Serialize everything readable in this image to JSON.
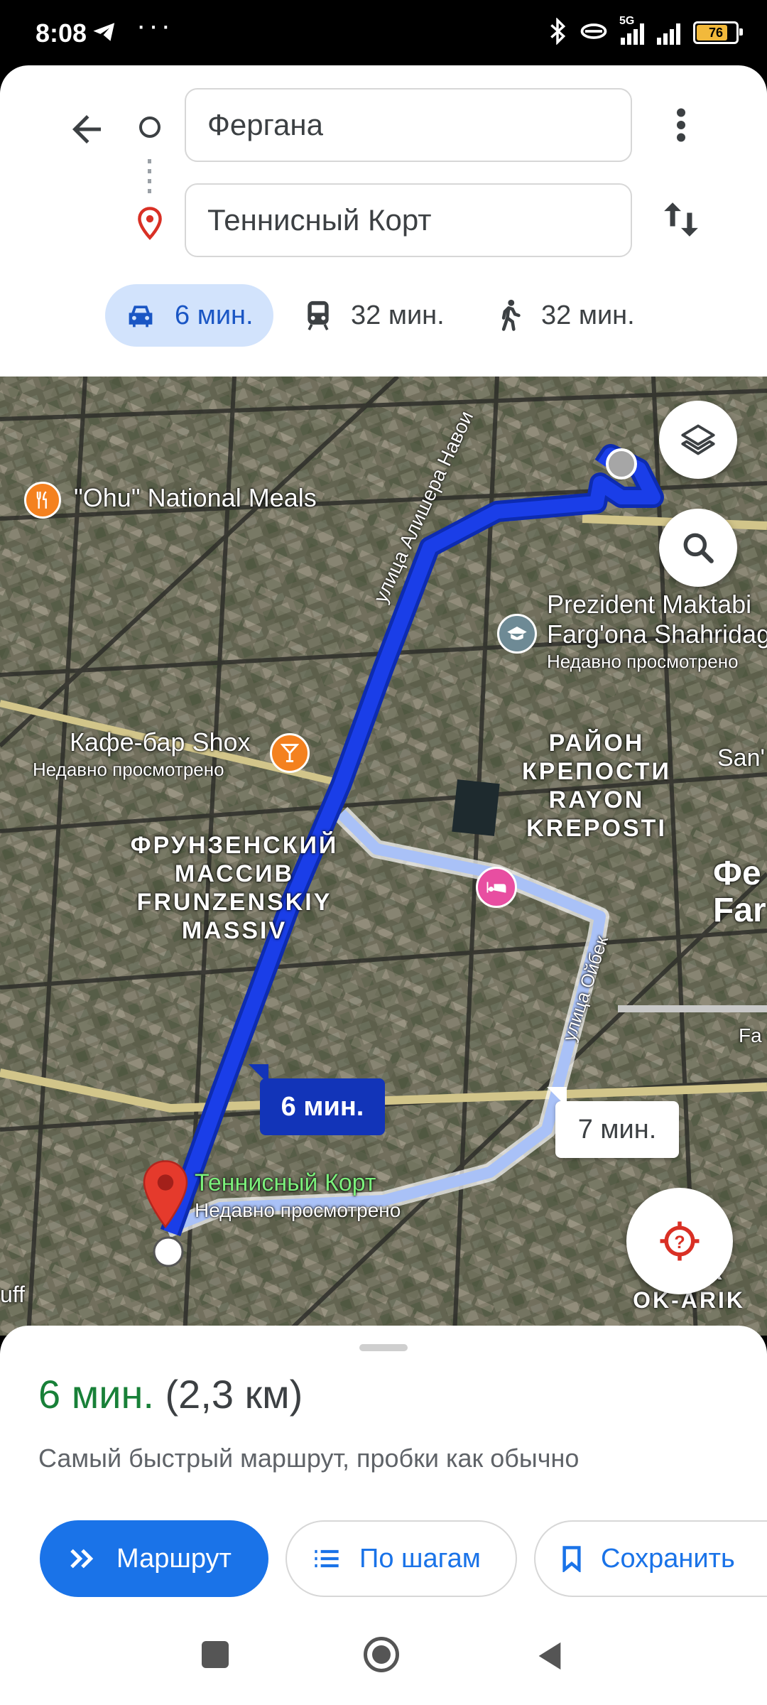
{
  "status_bar": {
    "time": "8:08",
    "network": "5G",
    "battery": "76",
    "icons": [
      "telegram-icon",
      "more-dots-icon",
      "bluetooth-icon",
      "link-icon",
      "signal-icon",
      "battery-icon"
    ]
  },
  "directions": {
    "origin": "Фергана",
    "destination": "Теннисный Корт",
    "modes": [
      {
        "icon": "car-icon",
        "label": "6 мин."
      },
      {
        "icon": "transit-icon",
        "label": "32 мин."
      },
      {
        "icon": "walk-icon",
        "label": "32 мин."
      }
    ]
  },
  "map": {
    "places": {
      "ohu": "\"Ohu\" National Meals",
      "president_line1": "Prezident Maktabi",
      "president_line2": "Farg'ona Shahridag",
      "president_sub": "Недавно просмотрено",
      "cafe": "Кафе-бар Shox",
      "cafe_sub": "Недавно просмотрено",
      "destination_label": "Теннисный Корт",
      "destination_sub": "Недавно просмотрено",
      "san": "San'",
      "fe1": "Фе",
      "fe2": "Far",
      "fa": "Fa",
      "uff": "uff"
    },
    "districts": {
      "kreposti": [
        "РАЙОН",
        "КРЕПОСТИ",
        "RAYON",
        "KREPOSTI"
      ],
      "frunzensky": [
        "ФРУНЗЕНСКИЙ",
        "МАССИВ",
        "FRUNZENSKIY",
        "MASSIV"
      ],
      "okarik": [
        "АРИК",
        "OK-ARIK"
      ]
    },
    "streets": {
      "navoi": "улица Алишера Навои",
      "oybek": "улица Ойбек"
    },
    "route_main_time": "6 мин.",
    "route_alt_time": "7 мин.",
    "colors": {
      "route_main": "#1a3ee8",
      "route_alt": "#a9c1f7",
      "accent": "#1a73e8",
      "time_green": "#188038"
    }
  },
  "summary": {
    "time": "6 мин.",
    "distance": "(2,3 км)",
    "description": "Самый быстрый маршрут, пробки как обычно"
  },
  "actions": {
    "start": "Маршрут",
    "steps": "По шагам",
    "save": "Сохранить"
  }
}
